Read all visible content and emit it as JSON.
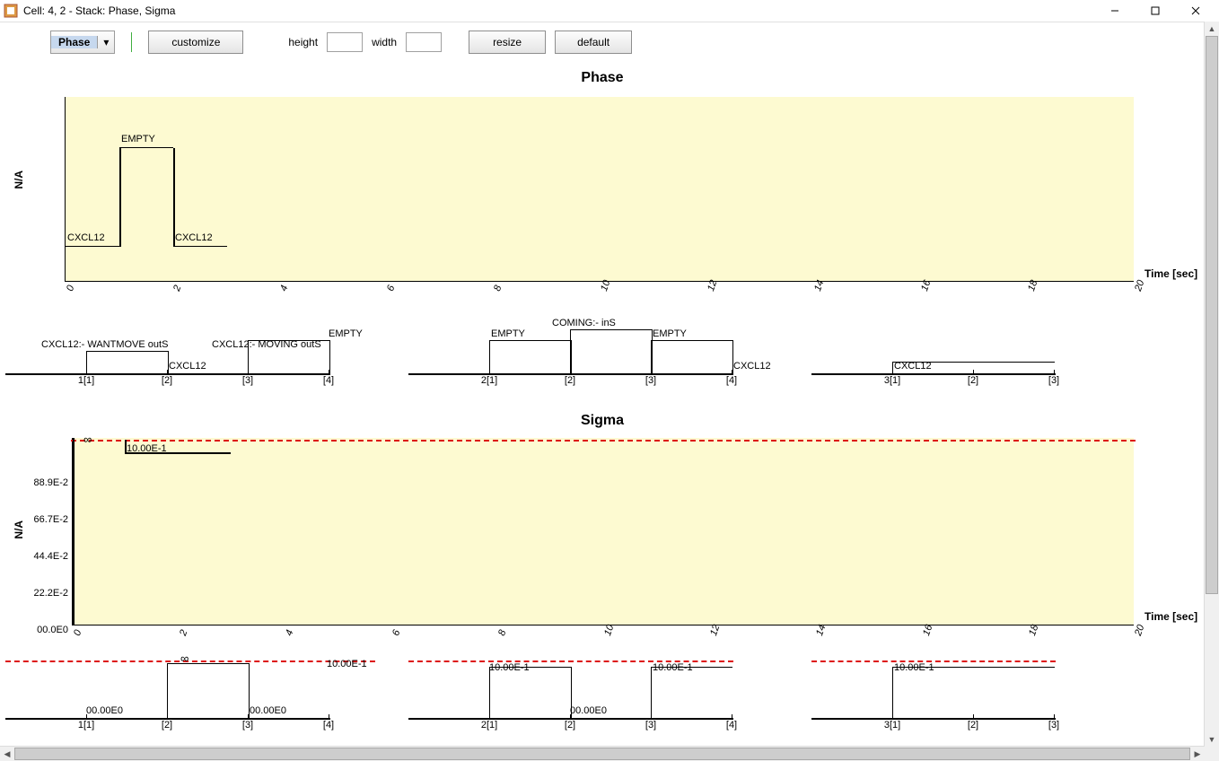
{
  "window": {
    "title": "Cell: 4, 2 - Stack: Phase, Sigma"
  },
  "toolbar": {
    "dropdown_selected": "Phase",
    "customize": "customize",
    "height_label": "height",
    "width_label": "width",
    "height_value": "",
    "width_value": "",
    "resize": "resize",
    "default": "default"
  },
  "charts": {
    "phase": {
      "title": "Phase",
      "ylabel": "N/A",
      "xlabel": "Time [sec]"
    },
    "sigma": {
      "title": "Sigma",
      "ylabel": "N/A",
      "xlabel": "Time [sec]"
    }
  },
  "chart_data": [
    {
      "type": "line",
      "name": "Phase",
      "title": "Phase",
      "xlabel": "Time [sec]",
      "ylabel": "N/A",
      "x_ticks": [
        0,
        2,
        4,
        6,
        8,
        10,
        12,
        14,
        16,
        18,
        20
      ],
      "xlim": [
        0,
        20
      ],
      "y_categories": [
        "CXCL12",
        "EMPTY"
      ],
      "series": [
        {
          "name": "phase_state",
          "segments": [
            {
              "x0": 0,
              "x1": 1,
              "state": "CXCL12"
            },
            {
              "x0": 1,
              "x1": 2,
              "state": "EMPTY"
            },
            {
              "x0": 2,
              "x1": 3,
              "state": "CXCL12"
            }
          ]
        }
      ],
      "annotations": [
        {
          "x": 0,
          "y": "CXCL12",
          "text": "CXCL12"
        },
        {
          "x": 1,
          "y": "EMPTY",
          "text": "EMPTY"
        },
        {
          "x": 2,
          "y": "CXCL12",
          "text": "CXCL12"
        }
      ],
      "sub_timelines": [
        {
          "origin": 1,
          "ticks": [
            "1[1]",
            "[2]",
            "[3]",
            "[4]"
          ],
          "events": [
            {
              "tick": 0,
              "text": "CXCL12:- WANTMOVE outS",
              "level": 1
            },
            {
              "tick": 1,
              "text": "CXCL12",
              "level": 0
            },
            {
              "tick": 2,
              "text": "CXCL12:- MOVING outS",
              "level": 1
            },
            {
              "tick": 3,
              "text": "EMPTY",
              "level": 2
            }
          ]
        },
        {
          "origin": 2,
          "ticks": [
            "2[1]",
            "[2]",
            "[3]",
            "[4]"
          ],
          "events": [
            {
              "tick": 0,
              "text": "EMPTY",
              "level": 1
            },
            {
              "tick": 1,
              "text": "COMING:- inS",
              "level": 2
            },
            {
              "tick": 2,
              "text": "EMPTY",
              "level": 1
            },
            {
              "tick": 3,
              "text": "CXCL12",
              "level": 0
            }
          ]
        },
        {
          "origin": 3,
          "ticks": [
            "3[1]",
            "[2]",
            "[3]"
          ],
          "events": [
            {
              "tick": 0,
              "text": "CXCL12",
              "level": 0
            }
          ]
        }
      ]
    },
    {
      "type": "line",
      "name": "Sigma",
      "title": "Sigma",
      "xlabel": "Time [sec]",
      "ylabel": "N/A",
      "x_ticks": [
        0,
        2,
        4,
        6,
        8,
        10,
        12,
        14,
        16,
        18,
        20
      ],
      "xlim": [
        0,
        20
      ],
      "y_ticks": [
        "00.0E0",
        "22.2E-2",
        "44.4E-2",
        "66.7E-2",
        "88.9E-2"
      ],
      "ylim": [
        0,
        1.0
      ],
      "infinity_line": true,
      "series": [
        {
          "name": "sigma",
          "points": [
            {
              "x": 0,
              "y": "inf"
            },
            {
              "x": 1,
              "y": 1.0,
              "label": "10.00E-1"
            },
            {
              "x": 2,
              "y": "inf"
            }
          ]
        }
      ],
      "sub_timelines": [
        {
          "origin": 1,
          "ticks": [
            "1[1]",
            "[2]",
            "[3]",
            "[4]"
          ],
          "top_dash": true,
          "inf_marker": "∞",
          "events": [
            {
              "tick": 0,
              "text": "00.00E0",
              "y": 0
            },
            {
              "tick": 2,
              "text": "00.00E0",
              "y": 0
            },
            {
              "tick": 3,
              "text": "10.00E-1",
              "y": 1
            }
          ]
        },
        {
          "origin": 2,
          "ticks": [
            "2[1]",
            "[2]",
            "[3]",
            "[4]"
          ],
          "top_dash": true,
          "events": [
            {
              "tick": 0,
              "text": "10.00E-1",
              "y": 1
            },
            {
              "tick": 1,
              "text": "00.00E0",
              "y": 0
            },
            {
              "tick": 2,
              "text": "10.00E-1",
              "y": 1
            }
          ]
        },
        {
          "origin": 3,
          "ticks": [
            "3[1]",
            "[2]",
            "[3]"
          ],
          "top_dash": true,
          "events": [
            {
              "tick": 0,
              "text": "10.00E-1",
              "y": 1
            }
          ]
        }
      ]
    }
  ]
}
